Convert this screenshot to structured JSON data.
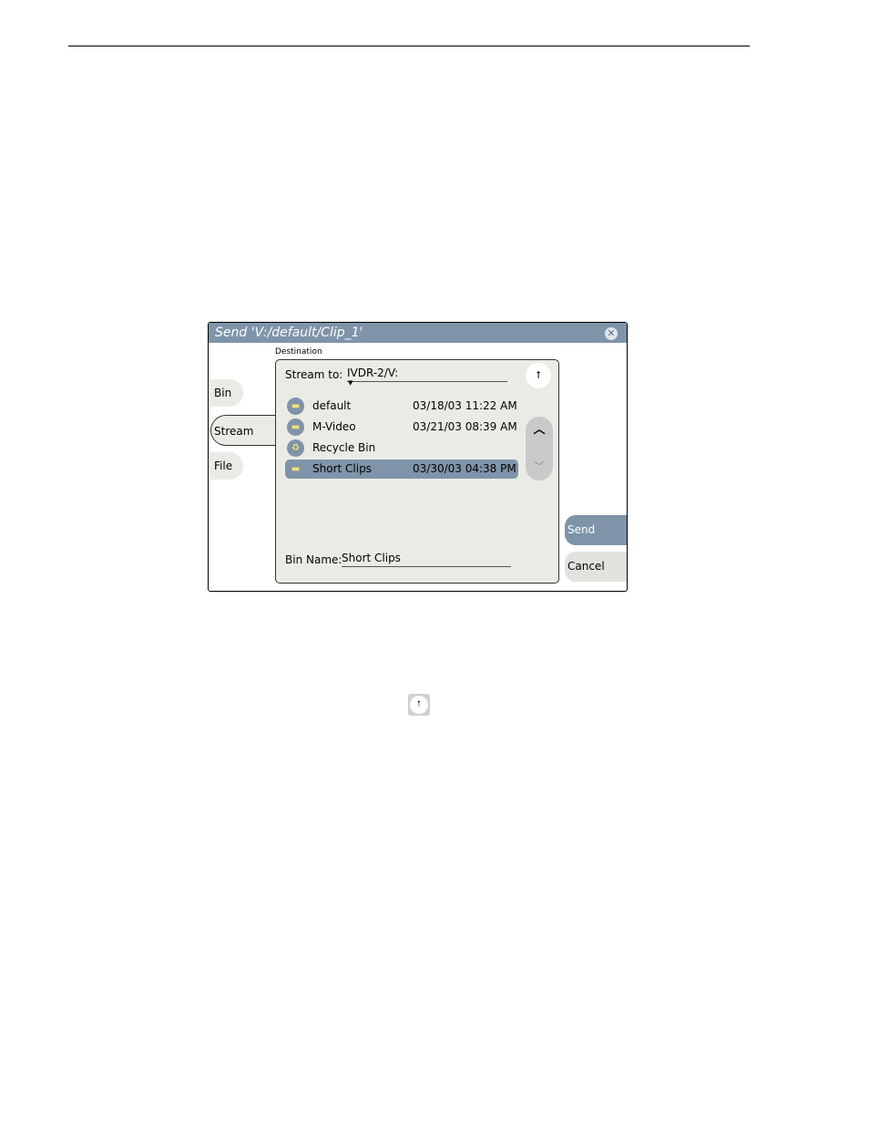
{
  "dialog": {
    "title": "Send 'V:/default/Clip_1'",
    "close_icon": "close-icon",
    "destination_label": "Destination",
    "tabs": [
      {
        "label": "Bin"
      },
      {
        "label": "Stream"
      },
      {
        "label": "File"
      }
    ],
    "stream_to_label": "Stream to:",
    "stream_to_value": "IVDR-2/V:",
    "up_level_icon": "up-level-icon",
    "items": [
      {
        "name": "default",
        "date": "03/18/03 11:22 AM",
        "icon": "folder-icon"
      },
      {
        "name": "M-Video",
        "date": "03/21/03 08:39 AM",
        "icon": "folder-icon"
      },
      {
        "name": "Recycle Bin",
        "date": "",
        "icon": "recycle-bin-icon"
      },
      {
        "name": "Short Clips",
        "date": "03/30/03 04:38 PM",
        "icon": "folder-icon",
        "selected": true
      }
    ],
    "bin_name_label": "Bin Name:",
    "bin_name_value": "Short Clips",
    "send_label": "Send",
    "cancel_label": "Cancel"
  },
  "colors": {
    "titlebar": "#7f94a9",
    "panel": "#ebebe6",
    "selected_row": "#7f94a9"
  }
}
